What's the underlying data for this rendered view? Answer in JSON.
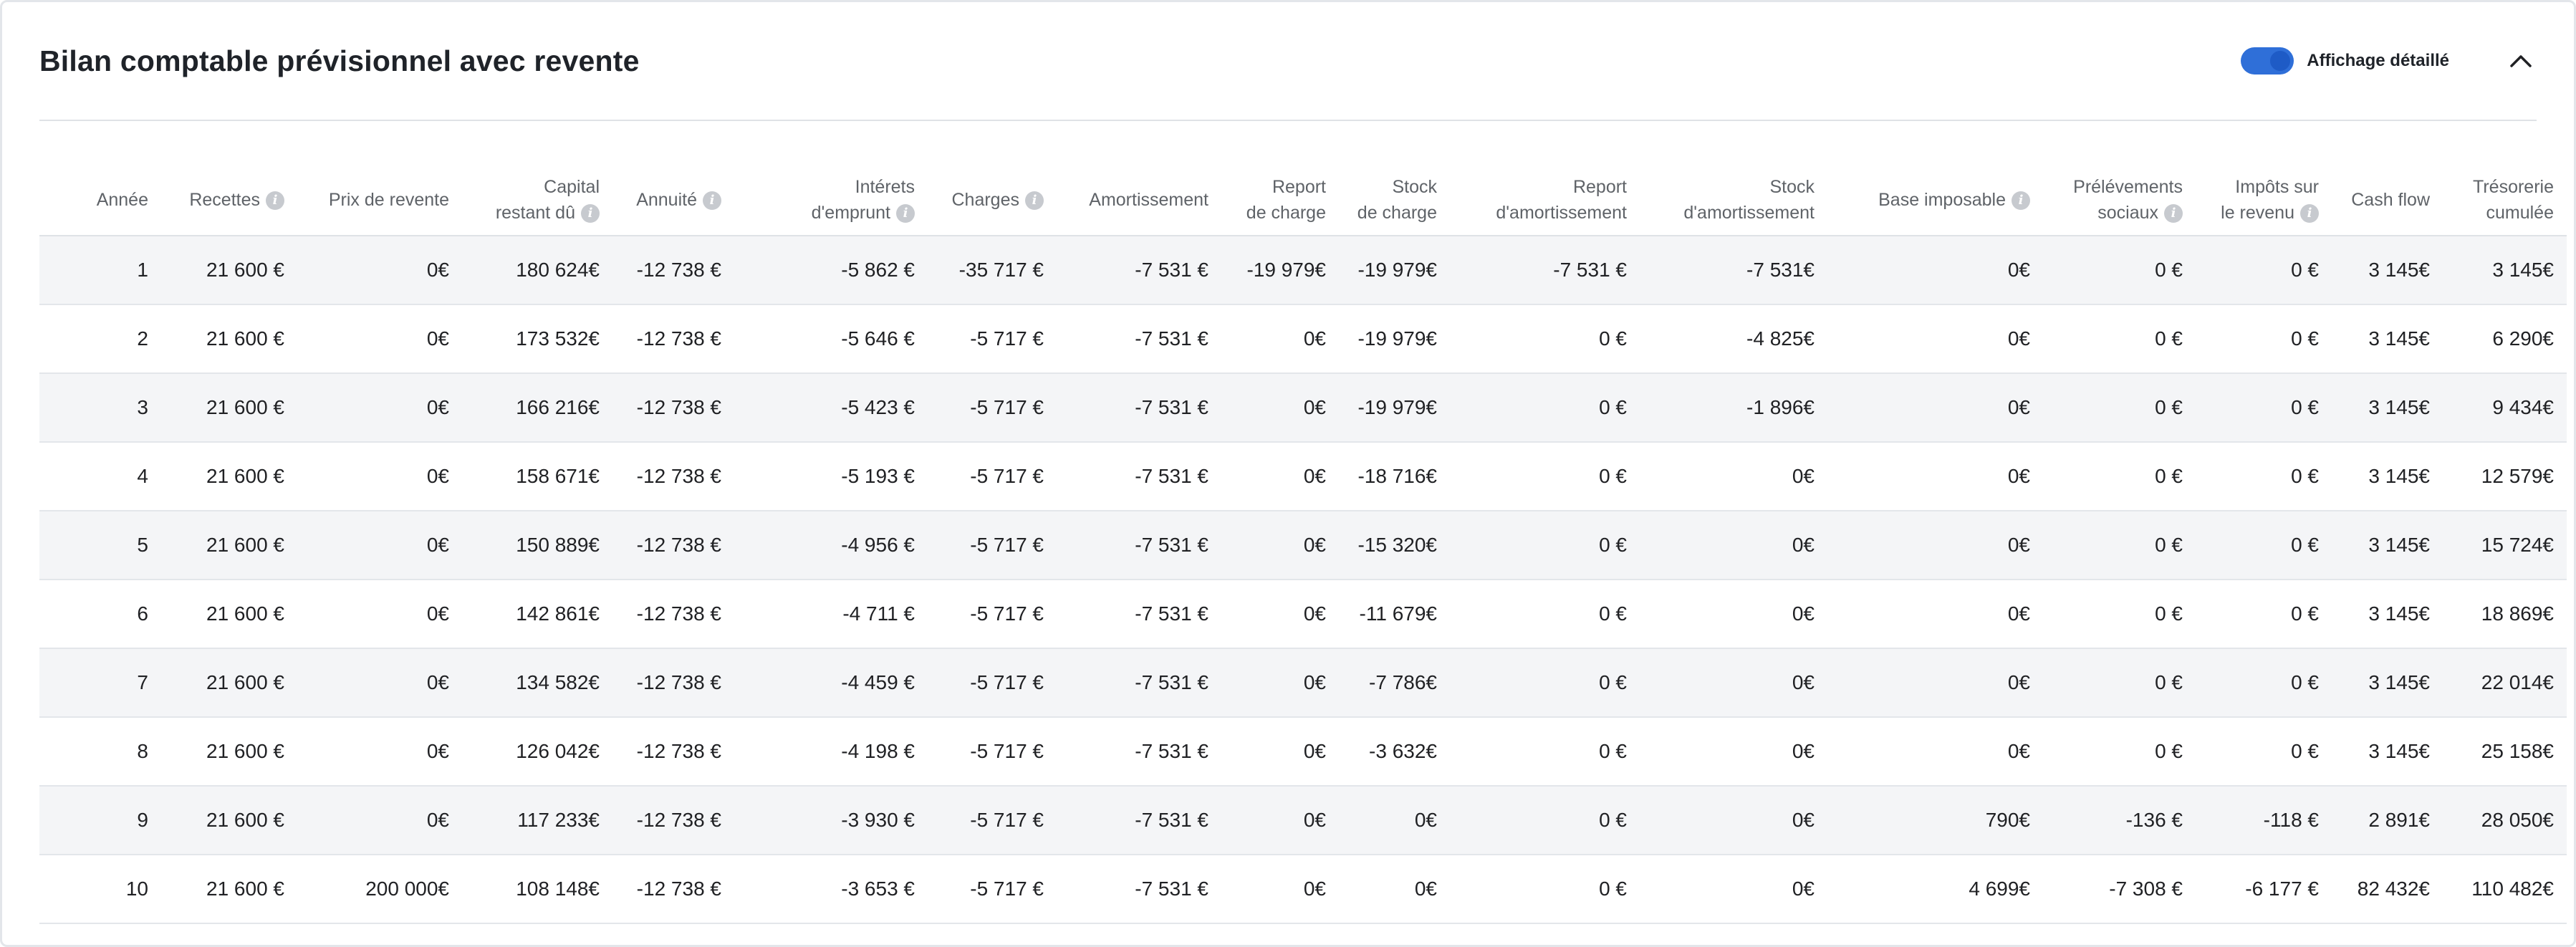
{
  "header": {
    "title": "Bilan comptable prévisionnel avec revente",
    "toggle_label": "Affichage détaillé",
    "toggle_on": true,
    "collapse_icon": "chevron-up-icon"
  },
  "table": {
    "columns": [
      {
        "key": "annee",
        "line1": "",
        "line2": "Année",
        "info": false
      },
      {
        "key": "recettes",
        "line1": "",
        "line2": "Recettes",
        "info": true
      },
      {
        "key": "prix_revente",
        "line1": "",
        "line2": "Prix de revente",
        "info": false
      },
      {
        "key": "capital",
        "line1": "Capital",
        "line2": "restant dû",
        "info": true
      },
      {
        "key": "annuite",
        "line1": "",
        "line2": "Annuité",
        "info": true
      },
      {
        "key": "interets",
        "line1": "Intérets",
        "line2": "d'emprunt",
        "info": true
      },
      {
        "key": "charges",
        "line1": "",
        "line2": "Charges",
        "info": true
      },
      {
        "key": "amortissement",
        "line1": "",
        "line2": "Amortissement",
        "info": false
      },
      {
        "key": "report_charge",
        "line1": "Report",
        "line2": "de charge",
        "info": false
      },
      {
        "key": "stock_charge",
        "line1": "Stock",
        "line2": "de charge",
        "info": false
      },
      {
        "key": "report_amort",
        "line1": "Report",
        "line2": "d'amortissement",
        "info": false
      },
      {
        "key": "stock_amort",
        "line1": "Stock",
        "line2": "d'amortissement",
        "info": false
      },
      {
        "key": "base",
        "line1": "",
        "line2": "Base imposable",
        "info": true
      },
      {
        "key": "prelevements",
        "line1": "Prélévements",
        "line2": "sociaux",
        "info": true
      },
      {
        "key": "impots",
        "line1": "Impôts sur",
        "line2": "le revenu",
        "info": true
      },
      {
        "key": "cashflow",
        "line1": "",
        "line2": "Cash flow",
        "info": false
      },
      {
        "key": "tresorerie",
        "line1": "Trésorerie",
        "line2": "cumulée",
        "info": false
      }
    ],
    "rows": [
      [
        "1",
        "21 600 €",
        "0€",
        "180 624€",
        "-12 738 €",
        "-5 862 €",
        "-35 717 €",
        "-7 531 €",
        "-19 979€",
        "-19 979€",
        "-7 531 €",
        "-7 531€",
        "0€",
        "0 €",
        "0 €",
        "3 145€",
        "3 145€"
      ],
      [
        "2",
        "21 600 €",
        "0€",
        "173 532€",
        "-12 738 €",
        "-5 646 €",
        "-5 717 €",
        "-7 531 €",
        "0€",
        "-19 979€",
        "0 €",
        "-4 825€",
        "0€",
        "0 €",
        "0 €",
        "3 145€",
        "6 290€"
      ],
      [
        "3",
        "21 600 €",
        "0€",
        "166 216€",
        "-12 738 €",
        "-5 423 €",
        "-5 717 €",
        "-7 531 €",
        "0€",
        "-19 979€",
        "0 €",
        "-1 896€",
        "0€",
        "0 €",
        "0 €",
        "3 145€",
        "9 434€"
      ],
      [
        "4",
        "21 600 €",
        "0€",
        "158 671€",
        "-12 738 €",
        "-5 193 €",
        "-5 717 €",
        "-7 531 €",
        "0€",
        "-18 716€",
        "0 €",
        "0€",
        "0€",
        "0 €",
        "0 €",
        "3 145€",
        "12 579€"
      ],
      [
        "5",
        "21 600 €",
        "0€",
        "150 889€",
        "-12 738 €",
        "-4 956 €",
        "-5 717 €",
        "-7 531 €",
        "0€",
        "-15 320€",
        "0 €",
        "0€",
        "0€",
        "0 €",
        "0 €",
        "3 145€",
        "15 724€"
      ],
      [
        "6",
        "21 600 €",
        "0€",
        "142 861€",
        "-12 738 €",
        "-4 711 €",
        "-5 717 €",
        "-7 531 €",
        "0€",
        "-11 679€",
        "0 €",
        "0€",
        "0€",
        "0 €",
        "0 €",
        "3 145€",
        "18 869€"
      ],
      [
        "7",
        "21 600 €",
        "0€",
        "134 582€",
        "-12 738 €",
        "-4 459 €",
        "-5 717 €",
        "-7 531 €",
        "0€",
        "-7 786€",
        "0 €",
        "0€",
        "0€",
        "0 €",
        "0 €",
        "3 145€",
        "22 014€"
      ],
      [
        "8",
        "21 600 €",
        "0€",
        "126 042€",
        "-12 738 €",
        "-4 198 €",
        "-5 717 €",
        "-7 531 €",
        "0€",
        "-3 632€",
        "0 €",
        "0€",
        "0€",
        "0 €",
        "0 €",
        "3 145€",
        "25 158€"
      ],
      [
        "9",
        "21 600 €",
        "0€",
        "117 233€",
        "-12 738 €",
        "-3 930 €",
        "-5 717 €",
        "-7 531 €",
        "0€",
        "0€",
        "0 €",
        "0€",
        "790€",
        "-136 €",
        "-118 €",
        "2 891€",
        "28 050€"
      ],
      [
        "10",
        "21 600 €",
        "200 000€",
        "108 148€",
        "-12 738 €",
        "-3 653 €",
        "-5 717 €",
        "-7 531 €",
        "0€",
        "0€",
        "0 €",
        "0€",
        "4 699€",
        "-7 308 €",
        "-6 177 €",
        "82 432€",
        "110 482€"
      ]
    ]
  }
}
